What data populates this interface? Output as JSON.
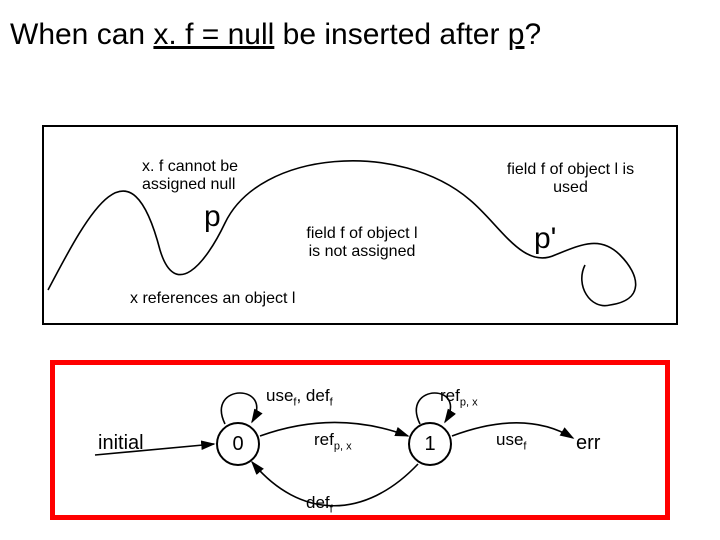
{
  "title": {
    "pre": "When can ",
    "u1": "x. f = null",
    "mid": " be inserted after ",
    "u2": "p",
    "post": "?"
  },
  "diagram": {
    "ann_cannot": "x. f cannot be\nassigned null",
    "p_label": "p",
    "ann_not_assigned": "field f of object l\nis not assigned",
    "ann_used": "field f of object l is\nused",
    "pprime_label": "p'",
    "refs_label": "x references an object l"
  },
  "automaton": {
    "initial_label": "initial",
    "state0": "0",
    "state1": "1",
    "state_err": "err",
    "lbl_usedef": "use_f, def_f",
    "lbl_refpx_top": "ref_p, x",
    "lbl_refpx_loop": "ref_p, x",
    "lbl_deff": "def_f",
    "lbl_usef": "use_f"
  }
}
